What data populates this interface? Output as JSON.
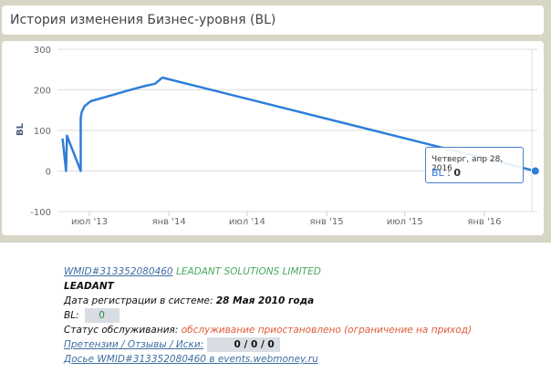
{
  "title": "История изменения Бизнес-уровня (BL)",
  "chart_data": {
    "type": "line",
    "ylabel": "BL",
    "ylim": [
      -100,
      300
    ],
    "yticks": [
      "300",
      "200",
      "100",
      "0",
      "-100"
    ],
    "yvalues": [
      300,
      200,
      100,
      0,
      -100
    ],
    "xticks": [
      {
        "label": "июл '13",
        "date": "2013-07-01"
      },
      {
        "label": "янв '14",
        "date": "2014-01-01"
      },
      {
        "label": "июл '14",
        "date": "2014-07-01"
      },
      {
        "label": "янв '15",
        "date": "2015-01-01"
      },
      {
        "label": "июл '15",
        "date": "2015-07-01"
      },
      {
        "label": "янв '16",
        "date": "2016-01-01"
      }
    ],
    "series": [
      {
        "name": "BL",
        "color": "#2f7ed8",
        "points": [
          [
            "2013-04-30",
            80
          ],
          [
            "2013-05-08",
            0
          ],
          [
            "2013-05-10",
            87
          ],
          [
            "2013-06-11",
            0
          ],
          [
            "2013-06-11",
            130
          ],
          [
            "2013-06-13",
            145
          ],
          [
            "2013-06-20",
            160
          ],
          [
            "2013-07-04",
            172
          ],
          [
            "2013-08-16",
            185
          ],
          [
            "2013-09-27",
            198
          ],
          [
            "2013-11-09",
            210
          ],
          [
            "2013-11-30",
            215
          ],
          [
            "2013-12-17",
            230
          ],
          [
            "2016-04-28",
            0
          ]
        ]
      }
    ],
    "tooltip": {
      "date": "Четверг, апр 28, 2016",
      "label": "BL",
      "value": "0"
    }
  },
  "info": {
    "wmid_link": "WMID#313352080460",
    "company": "LEADANT SOLUTIONS LIMITED",
    "name": "LEADANT",
    "reg_label": "Дата регистрации в системе:",
    "reg_date": "28 Мая 2010 года",
    "bl_label": "BL:",
    "bl_value": "0",
    "status_label": "Статус обслуживания:",
    "status_value": "обслуживание приостановлено (ограничение на приход)",
    "claims_link": "Претензии / Отзывы / Иски:",
    "claims_value": "0 / 0 / 0",
    "dossier_link": "Досье WMID#313352080460 в events.webmoney.ru"
  }
}
